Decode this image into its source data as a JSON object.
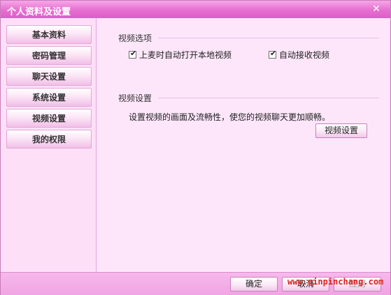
{
  "window": {
    "title": "个人资料及设置",
    "close_glyph": "✕"
  },
  "sidebar": {
    "items": [
      {
        "label": "基本资料"
      },
      {
        "label": "密码管理"
      },
      {
        "label": "聊天设置"
      },
      {
        "label": "系统设置"
      },
      {
        "label": "视频设置"
      },
      {
        "label": "我的权限"
      }
    ]
  },
  "video_options": {
    "title": "视频选项",
    "checkbox_1": {
      "label": "上麦时自动打开本地视频",
      "checked": true
    },
    "checkbox_2": {
      "label": "自动接收视频",
      "checked": true
    }
  },
  "video_settings": {
    "title": "视频设置",
    "description": "设置视频的画面及流畅性，使您的视频聊天更加顺畅。",
    "button_label": "视频设置"
  },
  "footer": {
    "ok_label": "确定",
    "cancel_label": "取消",
    "apply_label": "应用",
    "watermark": "www.qinpinchang.com"
  },
  "colors": {
    "accent": "#e66fd0",
    "panel": "#fde6fa"
  },
  "icons": {
    "checkmark": "✔"
  }
}
